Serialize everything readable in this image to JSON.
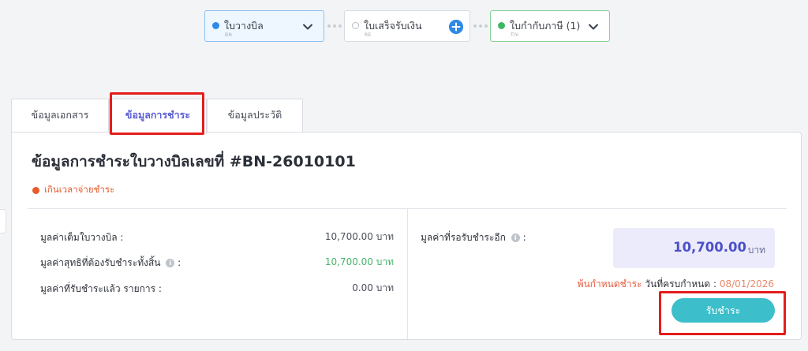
{
  "flow": {
    "steps": [
      {
        "title": "ใบวางบิล",
        "code": "BN"
      },
      {
        "title": "ใบเสร็จรับเงิน",
        "code": "RE"
      },
      {
        "title": "ใบกำกับภาษี (1)",
        "code": "TIV"
      }
    ]
  },
  "tabs": [
    {
      "label": "ข้อมูลเอกสาร"
    },
    {
      "label": "ข้อมูลการชำระ"
    },
    {
      "label": "ข้อมูลประวัติ"
    }
  ],
  "panel": {
    "title": "ข้อมูลการชำระใบวางบิลเลขที่ #BN-26010101",
    "status": "เกินเวลาจ่ายชำระ",
    "rows": [
      {
        "label": "มูลค่าเต็มใบวางบิล :",
        "value": "10,700.00 บาท"
      },
      {
        "label": "มูลค่าสุทธิที่ต้องรับชำระทั้งสิ้น",
        "suffix": ":",
        "value": "10,700.00 บาท"
      },
      {
        "label": "มูลค่าที่รับชำระแล้ว รายการ :",
        "value": "0.00 บาท"
      }
    ],
    "remaining": {
      "label": "มูลค่าที่รอรับชำระอีก",
      "suffix": ":",
      "amount": "10,700.00",
      "unit": "บาท"
    },
    "due": {
      "overdue_text": "พ้นกำหนดชำระ",
      "label": "วันที่ครบกำหนด :",
      "date": "08/01/2026"
    },
    "pay_button": "รับชำระ"
  },
  "colors": {
    "accent": "#5b5fd6",
    "primary_blue": "#2f8ae6",
    "success": "#45b46c",
    "danger": "#e8593a",
    "button": "#3cbfcb",
    "highlight": "#e51c1c"
  }
}
